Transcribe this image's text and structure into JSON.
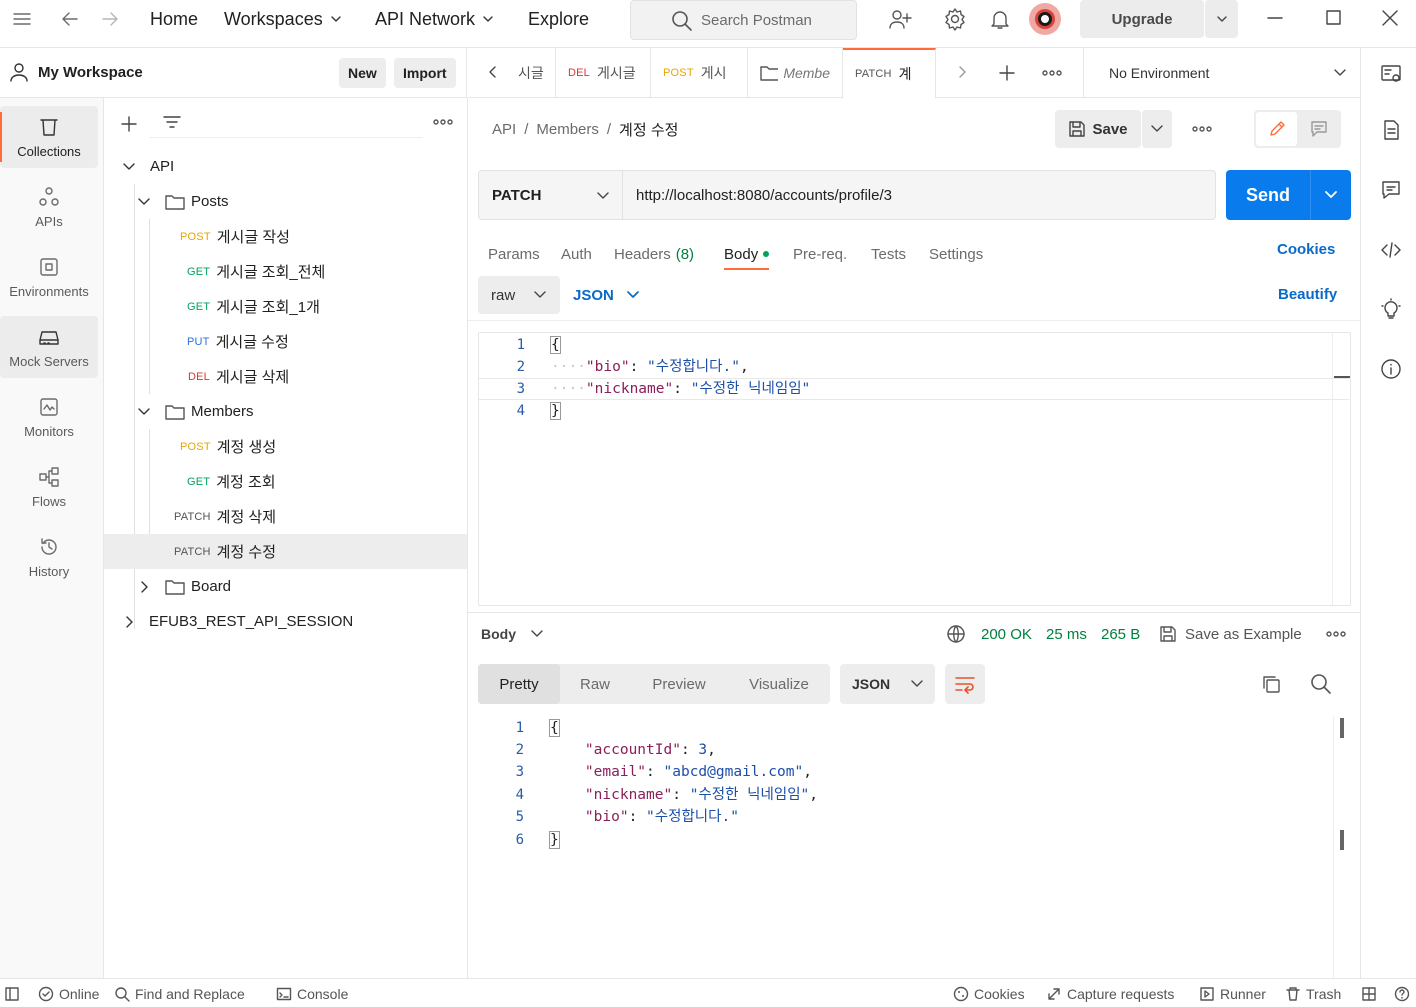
{
  "topbar": {
    "home": "Home",
    "workspaces": "Workspaces",
    "api_network": "API Network",
    "explore": "Explore",
    "search_placeholder": "Search Postman",
    "upgrade": "Upgrade"
  },
  "workspace": {
    "name": "My Workspace",
    "new_label": "New",
    "import_label": "Import"
  },
  "nav": [
    {
      "label": "Collections",
      "icon": "collections-icon"
    },
    {
      "label": "APIs",
      "icon": "apis-icon"
    },
    {
      "label": "Environments",
      "icon": "environments-icon"
    },
    {
      "label": "Mock Servers",
      "icon": "mock-servers-icon"
    },
    {
      "label": "Monitors",
      "icon": "monitors-icon"
    },
    {
      "label": "Flows",
      "icon": "flows-icon"
    },
    {
      "label": "History",
      "icon": "history-icon"
    }
  ],
  "tree": {
    "api": "API",
    "posts": "Posts",
    "posts_items": [
      {
        "method": "POST",
        "name": "게시글 작성"
      },
      {
        "method": "GET",
        "name": "게시글 조회_전체"
      },
      {
        "method": "GET",
        "name": "게시글 조회_1개"
      },
      {
        "method": "PUT",
        "name": "게시글 수정"
      },
      {
        "method": "DEL",
        "name": "게시글 삭제"
      }
    ],
    "members": "Members",
    "members_items": [
      {
        "method": "POST",
        "name": "계정 생성"
      },
      {
        "method": "GET",
        "name": "계정 조회"
      },
      {
        "method": "PATCH",
        "name": "계정 삭제"
      },
      {
        "method": "PATCH",
        "name": "계정 수정"
      }
    ],
    "board": "Board",
    "session": "EFUB3_REST_API_SESSION"
  },
  "tabs": [
    {
      "method": "",
      "name": "시글"
    },
    {
      "method": "DEL",
      "name": "게시글"
    },
    {
      "method": "POST",
      "name": "게시"
    },
    {
      "method": "",
      "name": "Membe"
    },
    {
      "method": "PATCH",
      "name": "계"
    }
  ],
  "environment": "No Environment",
  "breadcrumb": [
    "API",
    "Members",
    "계정 수정"
  ],
  "save_label": "Save",
  "request": {
    "method": "PATCH",
    "url": "http://localhost:8080/accounts/profile/3",
    "send_label": "Send",
    "tabs": [
      "Params",
      "Auth",
      "Headers",
      "(8)",
      "Body",
      "Pre-req.",
      "Tests",
      "Settings"
    ],
    "cookies_label": "Cookies",
    "body_type": "raw",
    "body_lang": "JSON",
    "beautify_label": "Beautify",
    "line_numbers": [
      "1",
      "2",
      "3",
      "4"
    ],
    "body": {
      "open": "{",
      "k1": "\"bio\"",
      "v1": "\"수정합니다.\"",
      "k2": "\"nickname\"",
      "v2": "\"수정한 닉네임임\"",
      "close": "}"
    }
  },
  "response": {
    "label": "Body",
    "status": "200 OK",
    "time": "25 ms",
    "size": "265 B",
    "save_example": "Save as Example",
    "view_tabs": [
      "Pretty",
      "Raw",
      "Preview",
      "Visualize"
    ],
    "format": "JSON",
    "line_numbers": [
      "1",
      "2",
      "3",
      "4",
      "5",
      "6"
    ],
    "body": {
      "open": "{",
      "k1": "\"accountId\"",
      "v1": "3",
      "k2": "\"email\"",
      "v2": "\"abcd@gmail.com\"",
      "k3": "\"nickname\"",
      "v3": "\"수정한 닉네임임\"",
      "k4": "\"bio\"",
      "v4": "\"수정합니다.\"",
      "close": "}"
    }
  },
  "statusbar": {
    "online": "Online",
    "find_replace": "Find and Replace",
    "console": "Console",
    "cookies": "Cookies",
    "capture": "Capture requests",
    "runner": "Runner",
    "trash": "Trash"
  },
  "colors": {
    "accent": "#ff6c37",
    "send": "#097bed",
    "post": "#e8a400",
    "get": "#00a35c",
    "put": "#2a6fdb",
    "del": "#d8372c"
  }
}
